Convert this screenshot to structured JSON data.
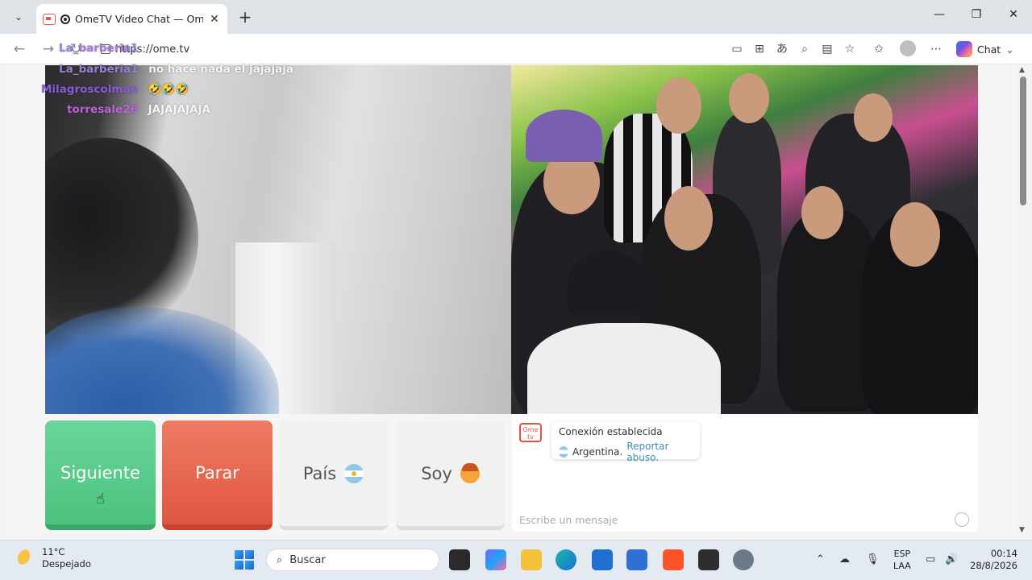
{
  "browser": {
    "tab_title": "OmeTV Video Chat — Omegle",
    "new_tab": "+",
    "url": "https://ome.tv",
    "copilot_label": "Chat",
    "controls": {
      "minimize": "—",
      "maximize": "❐",
      "close": "✕"
    }
  },
  "overlay_chat": [
    {
      "user": "La_barberia1",
      "message": "",
      "color": "#9b7fd4"
    },
    {
      "user": "La_barberia1",
      "message": "no hace nada el jajajaja",
      "color": "#9b7fd4"
    },
    {
      "user": "Milagroscolman",
      "message": "🤣🤣🤣",
      "color": "#8a5bd6"
    },
    {
      "user": "torresale26",
      "message": "JAJAJAJAJA",
      "color": "#c060d8"
    }
  ],
  "controls": {
    "next_label": "Siguiente",
    "stop_label": "Parar",
    "country_label": "País",
    "soy_label": "Soy"
  },
  "chat": {
    "logo_text": "Ome tv",
    "status": "Conexión establecida",
    "country": "Argentina.",
    "report_link": "Reportar abuso.",
    "input_placeholder": "Escribe un mensaje"
  },
  "taskbar": {
    "temperature": "11°C",
    "weather": "Despejado",
    "search_placeholder": "Buscar",
    "lang_line1": "ESP",
    "lang_line2": "LAA",
    "time": "00:14",
    "date": "28/8/2026"
  }
}
